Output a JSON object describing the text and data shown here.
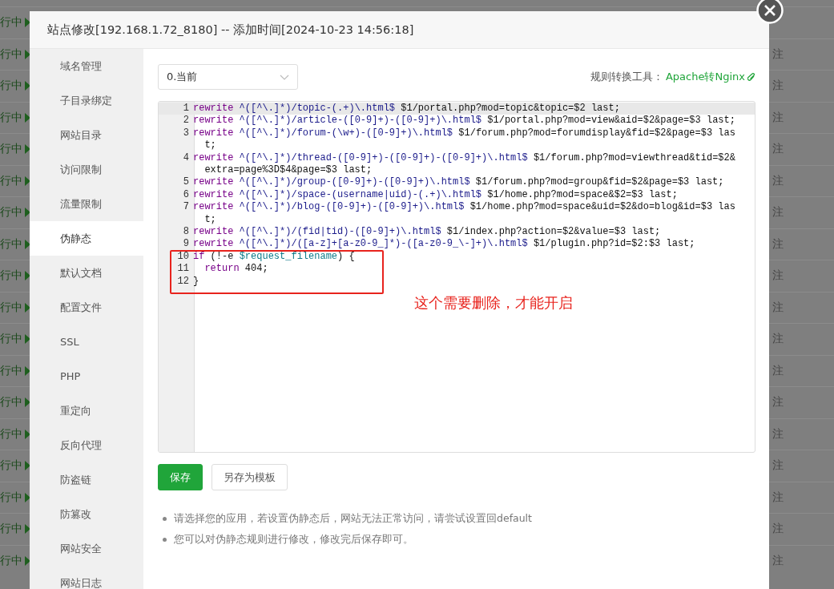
{
  "background_rows": [
    {
      "status": "行中"
    },
    {
      "status": "行中",
      "note": "注"
    },
    {
      "status": "行中",
      "note": "注"
    },
    {
      "status": "行中",
      "note": "注"
    },
    {
      "status": "行中",
      "note": "注"
    },
    {
      "status": "行中",
      "note": "注"
    },
    {
      "status": "行中",
      "note": "注"
    },
    {
      "status": "行中",
      "note": "注"
    },
    {
      "status": "行中",
      "note": "注"
    },
    {
      "status": "行中",
      "note": "注"
    },
    {
      "status": "行中",
      "note": "注"
    },
    {
      "status": "行中",
      "note": "注"
    },
    {
      "status": "行中",
      "note": "注"
    },
    {
      "status": "行中",
      "note": "注"
    },
    {
      "status": "行中",
      "note": "注"
    },
    {
      "status": "行中",
      "note": "注"
    },
    {
      "status": "行中",
      "note": "注"
    },
    {
      "status": "行中",
      "note": "注"
    }
  ],
  "dialog": {
    "title": "站点修改[192.168.1.72_8180] -- 添加时间[2024-10-23 14:56:18]"
  },
  "sidebar": {
    "items": [
      {
        "label": "域名管理",
        "selected": false
      },
      {
        "label": "子目录绑定",
        "selected": false
      },
      {
        "label": "网站目录",
        "selected": false
      },
      {
        "label": "访问限制",
        "selected": false
      },
      {
        "label": "流量限制",
        "selected": false
      },
      {
        "label": "伪静态",
        "selected": true
      },
      {
        "label": "默认文档",
        "selected": false
      },
      {
        "label": "配置文件",
        "selected": false
      },
      {
        "label": "SSL",
        "selected": false
      },
      {
        "label": "PHP",
        "selected": false
      },
      {
        "label": "重定向",
        "selected": false
      },
      {
        "label": "反向代理",
        "selected": false
      },
      {
        "label": "防盗链",
        "selected": false
      },
      {
        "label": "防篡改",
        "selected": false
      },
      {
        "label": "网站安全",
        "selected": false
      },
      {
        "label": "网站日志",
        "selected": false
      }
    ]
  },
  "template_select": {
    "value": "0.当前"
  },
  "converter": {
    "label": "规则转换工具：",
    "link": "Apache转Nginx"
  },
  "editor": {
    "lines": [
      {
        "number": "1",
        "tokens": [
          {
            "kind": "keyword",
            "text": "rewrite"
          },
          {
            "kind": "regex",
            "text": " ^([^\\.]*)/topic-(.+)\\.html$"
          },
          {
            "kind": "plain",
            "text": " $1/portal.php?mod=topic&topic=$2 last;"
          }
        ]
      },
      {
        "number": "2",
        "tokens": [
          {
            "kind": "keyword",
            "text": "rewrite"
          },
          {
            "kind": "regex",
            "text": " ^([^\\.]*)/article-([0-9]+)-([0-9]+)\\.html$"
          },
          {
            "kind": "plain",
            "text": " $1/portal.php?mod=view&aid=$2&page=$3 last;"
          }
        ]
      },
      {
        "number": "3",
        "tokens": [
          {
            "kind": "keyword",
            "text": "rewrite"
          },
          {
            "kind": "regex",
            "text": " ^([^\\.]*)/forum-(\\w+)-([0-9]+)\\.html$"
          },
          {
            "kind": "plain",
            "text": " $1/forum.php?mod=forumdisplay&fid=$2&page=$3 last;"
          }
        ]
      },
      {
        "number": "4",
        "tokens": [
          {
            "kind": "keyword",
            "text": "rewrite"
          },
          {
            "kind": "regex",
            "text": " ^([^\\.]*)/thread-([0-9]+)-([0-9]+)-([0-9]+)\\.html$"
          },
          {
            "kind": "plain",
            "text": " $1/forum.php?mod=viewthread&tid=$2&extra=page%3D$4&page=$3 last;"
          }
        ]
      },
      {
        "number": "5",
        "tokens": [
          {
            "kind": "keyword",
            "text": "rewrite"
          },
          {
            "kind": "regex",
            "text": " ^([^\\.]*)/group-([0-9]+)-([0-9]+)\\.html$"
          },
          {
            "kind": "plain",
            "text": " $1/forum.php?mod=group&fid=$2&page=$3 last;"
          }
        ]
      },
      {
        "number": "6",
        "tokens": [
          {
            "kind": "keyword",
            "text": "rewrite"
          },
          {
            "kind": "regex",
            "text": " ^([^\\.]*)/space-(username|uid)-(.+)\\.html$"
          },
          {
            "kind": "plain",
            "text": " $1/home.php?mod=space&$2=$3 last;"
          }
        ]
      },
      {
        "number": "7",
        "tokens": [
          {
            "kind": "keyword",
            "text": "rewrite"
          },
          {
            "kind": "regex",
            "text": " ^([^\\.]*)/blog-([0-9]+)-([0-9]+)\\.html$"
          },
          {
            "kind": "plain",
            "text": " $1/home.php?mod=space&uid=$2&do=blog&id=$3 last;"
          }
        ]
      },
      {
        "number": "8",
        "tokens": [
          {
            "kind": "keyword",
            "text": "rewrite"
          },
          {
            "kind": "regex",
            "text": " ^([^\\.]*)/(fid|tid)-([0-9]+)\\.html$"
          },
          {
            "kind": "plain",
            "text": " $1/index.php?action=$2&value=$3 last;"
          }
        ]
      },
      {
        "number": "9",
        "tokens": [
          {
            "kind": "keyword",
            "text": "rewrite"
          },
          {
            "kind": "regex",
            "text": " ^([^\\.]*)/([a-z]+[a-z0-9_]*)-([a-z0-9_\\-]+)\\.html$"
          },
          {
            "kind": "plain",
            "text": " $1/plugin.php?id=$2:$3 last;"
          }
        ]
      },
      {
        "number": "10",
        "tokens": [
          {
            "kind": "keyword",
            "text": "if"
          },
          {
            "kind": "plain",
            "text": " (!-e "
          },
          {
            "kind": "variable",
            "text": "$request_filename"
          },
          {
            "kind": "plain",
            "text": ") {"
          }
        ]
      },
      {
        "number": "11",
        "indented": true,
        "tokens": [
          {
            "kind": "keyword",
            "text": "return"
          },
          {
            "kind": "plain",
            "text": " 404;"
          }
        ]
      },
      {
        "number": "12",
        "tokens": [
          {
            "kind": "plain",
            "text": "}"
          }
        ]
      }
    ]
  },
  "annotation": {
    "text": "这个需要删除，才能开启"
  },
  "buttons": [
    {
      "label": "保存",
      "kind": "primary"
    },
    {
      "label": "另存为模板",
      "kind": "default"
    }
  ],
  "notes": [
    "请选择您的应用，若设置伪静态后，网站无法正常访问，请尝试设置回default",
    "您可以对伪静态规则进行修改，修改完后保存即可。"
  ]
}
